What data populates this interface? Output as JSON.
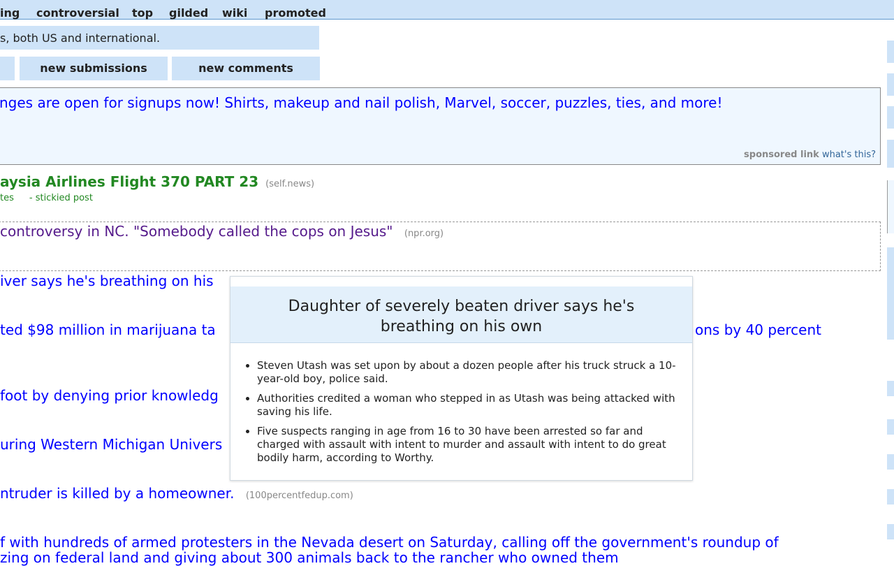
{
  "header": {
    "tabs": [
      "ing",
      "controversial",
      "top",
      "gilded",
      "wiki",
      "promoted"
    ]
  },
  "subreddit": {
    "description": "s, both US and international."
  },
  "buttons": {
    "new_submissions": "new submissions",
    "new_comments": "new comments"
  },
  "ad": {
    "text": "nges are open for signups now! Shirts, makeup and nail polish, Marvel, soccer, puzzles, ties, and more!",
    "sponsored": "sponsored link",
    "whats_this": "what's this?"
  },
  "sticky": {
    "title": "aysia Airlines Flight 370 PART 23",
    "domain": "(self.news)",
    "meta_left": "tes",
    "meta_right": "- stickied post"
  },
  "posts": [
    {
      "title": "controversy in NC. \"Somebody called the cops on Jesus\"",
      "domain": "(npr.org)"
    },
    {
      "title": "iver says he's breathing on his",
      "domain": ""
    },
    {
      "title": "ted $98 million in marijuana ta",
      "tail": "ons by 40 percent",
      "domain": ""
    },
    {
      "title": "foot by denying prior knowledg",
      "domain": ""
    },
    {
      "title": "uring Western Michigan Univers",
      "domain": ""
    },
    {
      "title": "ntruder is killed by a homeowner.",
      "domain": "(100percentfedup.com)"
    },
    {
      "title": "f with hundreds of armed protesters in the Nevada desert on Saturday, calling off the government's roundup of",
      "line2": "zing on federal land and giving about 300 animals back to the rancher who owned them",
      "domain": ""
    }
  ],
  "popup": {
    "title": "Daughter of severely beaten driver says he's breathing on his own",
    "bullets": [
      "Steven Utash was set upon by about a dozen people after his truck struck a 10-year-old boy, police said.",
      "Authorities credited a woman who stepped in as Utash was being attacked with saving his life.",
      "Five suspects ranging in age from 16 to 30 have been arrested so far and charged with assault with intent to murder and assault with intent to do great bodily harm, according to Worthy."
    ]
  },
  "colors": {
    "accent_blue": "#cee3f8",
    "link_blue": "#0000ff",
    "sticky_green": "#228822",
    "visited_purple": "#551a8b"
  }
}
